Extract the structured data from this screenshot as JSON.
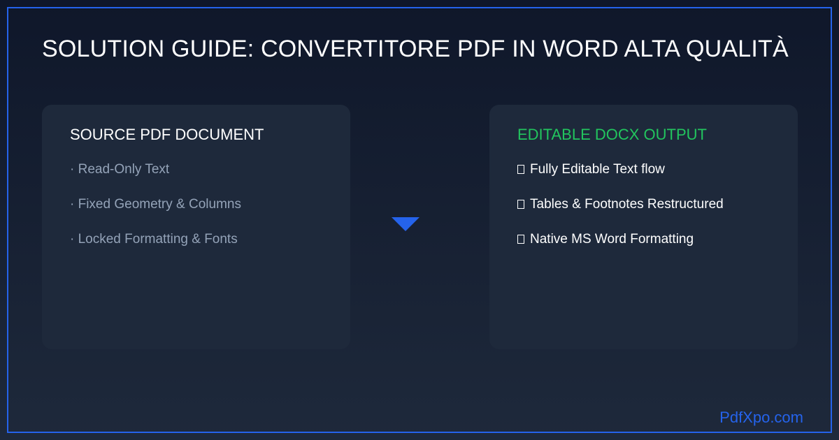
{
  "title": "SOLUTION GUIDE: CONVERTITORE PDF IN WORD ALTA QUALITÀ",
  "source": {
    "heading": "SOURCE PDF DOCUMENT",
    "items": [
      "· Read-Only Text",
      "· Fixed Geometry & Columns",
      "· Locked Formatting & Fonts"
    ]
  },
  "output": {
    "heading": "EDITABLE DOCX OUTPUT",
    "item_icon": "check-box-icon",
    "items": [
      "Fully Editable Text flow",
      "Tables & Footnotes Restructured",
      "Native MS Word Formatting"
    ]
  },
  "brand": "PdfXpo.com",
  "colors": {
    "accent": "#2563eb",
    "success": "#22c55e",
    "muted": "#94a3b8",
    "panel": "#1e293b",
    "background": "#0f172a"
  }
}
